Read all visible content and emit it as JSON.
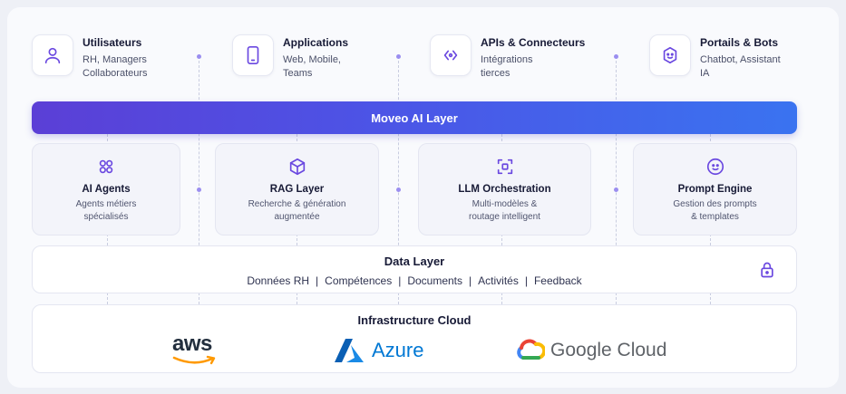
{
  "top_row": [
    {
      "title": "Utilisateurs",
      "subtitle": "RH, Managers\nCollaborateurs",
      "icon": "user-icon"
    },
    {
      "title": "Applications",
      "subtitle": "Web, Mobile,\nTeams",
      "icon": "mobile-icon"
    },
    {
      "title": "APIs & Connecteurs",
      "subtitle": "Intégrations\ntierces",
      "icon": "api-connector-icon"
    },
    {
      "title": "Portails & Bots",
      "subtitle": "Chatbot, Assistant\nIA",
      "icon": "bot-icon"
    }
  ],
  "ai_layer": {
    "label": "Moveo AI Layer"
  },
  "modules": [
    {
      "title": "AI Agents",
      "subtitle": "Agents métiers\nspécialisés",
      "icon": "agents-icon"
    },
    {
      "title": "RAG Layer",
      "subtitle": "Recherche & génération\naugmentée",
      "icon": "cube-icon"
    },
    {
      "title": "LLM Orchestration",
      "subtitle": "Multi-modèles &\nroutage intelligent",
      "icon": "orchestration-icon"
    },
    {
      "title": "Prompt Engine",
      "subtitle": "Gestion des prompts\n& templates",
      "icon": "prompt-icon"
    }
  ],
  "data_layer": {
    "title": "Data Layer",
    "items": [
      "Données RH",
      "Compétences",
      "Documents",
      "Activités",
      "Feedback"
    ],
    "separator": "|",
    "icon": "lock-icon"
  },
  "infrastructure": {
    "title": "Infrastructure Cloud",
    "providers": [
      {
        "name": "aws",
        "icon": "aws-logo"
      },
      {
        "name": "Azure",
        "icon": "azure-logo"
      },
      {
        "name": "Google Cloud",
        "icon": "google-cloud-logo"
      }
    ]
  },
  "colors": {
    "accent_purple": "#6a48e0",
    "bar_gradient_start": "#5b3fd6",
    "bar_gradient_end": "#3a73f0",
    "azure_blue": "#0078d4",
    "aws_orange": "#ff9900"
  }
}
